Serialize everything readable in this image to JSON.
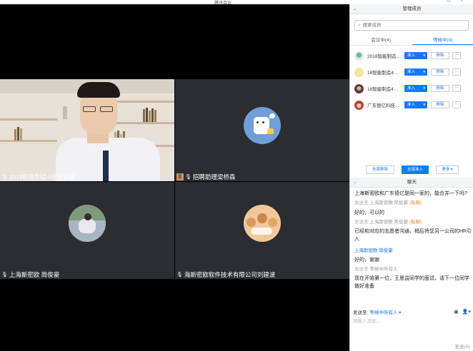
{
  "window": {
    "title": "腾讯会议"
  },
  "tiles": [
    {
      "name": "2018智能制造4班王思益",
      "active": true
    },
    {
      "name": "招聘助理梁桥森",
      "active": false
    },
    {
      "name": "上海斯密欧 简俊豪",
      "active": false
    },
    {
      "name": "海斯密欧软件技术有限公司刘建波",
      "active": false
    }
  ],
  "members_panel": {
    "title": "管理成员",
    "search_placeholder": "搜索成员",
    "tabs": [
      {
        "label": "会议中(4)",
        "selected": false
      },
      {
        "label": "等候中(4)",
        "selected": true
      }
    ],
    "members": [
      {
        "name": "2018智能制造...",
        "icon": "landscape-avatar-icon"
      },
      {
        "name": "18智能制造4班...",
        "icon": "cartoon-avatar-icon"
      },
      {
        "name": "18智能制造4班...",
        "icon": "photo-avatar-icon"
      },
      {
        "name": "广东德亿科技...",
        "icon": "girl-avatar-icon"
      }
    ],
    "enter_label": "准入",
    "remove_label": "移除",
    "more_label": "···",
    "bulk": {
      "remove_all": "全部移除",
      "admit_all": "全部准入",
      "more": "更多"
    }
  },
  "chat": {
    "title": "聊天",
    "messages": [
      {
        "kind": "text",
        "text": "上海斯密欧和广东德亿是同一家的，能合并一下吗?"
      },
      {
        "kind": "meta",
        "prefix": "发送至",
        "who": "上海斯密欧 简俊豪",
        "tag": "(私聊)"
      },
      {
        "kind": "text",
        "text": "好的，可以的"
      },
      {
        "kind": "meta",
        "prefix": "发送至",
        "who": "上海斯密欧 简俊豪",
        "tag": "(私聊)"
      },
      {
        "kind": "text",
        "text": "已经和对应的志愿者沟通，稍后将您另一公司的HR引入"
      },
      {
        "kind": "sender",
        "text": "上海斯密欧 简俊豪"
      },
      {
        "kind": "text",
        "text": "好的，谢谢"
      },
      {
        "kind": "meta",
        "prefix": "发送至",
        "who": "等候中所有人",
        "tag": ""
      },
      {
        "kind": "text",
        "text": "现在开始第一位，王思益同学的面试，请下一位同学做好准备"
      }
    ],
    "send_to_label": "发送至:",
    "send_to_target": "等候中所有人",
    "input_placeholder": "请输入消息...",
    "send_label": "发送(S)"
  }
}
